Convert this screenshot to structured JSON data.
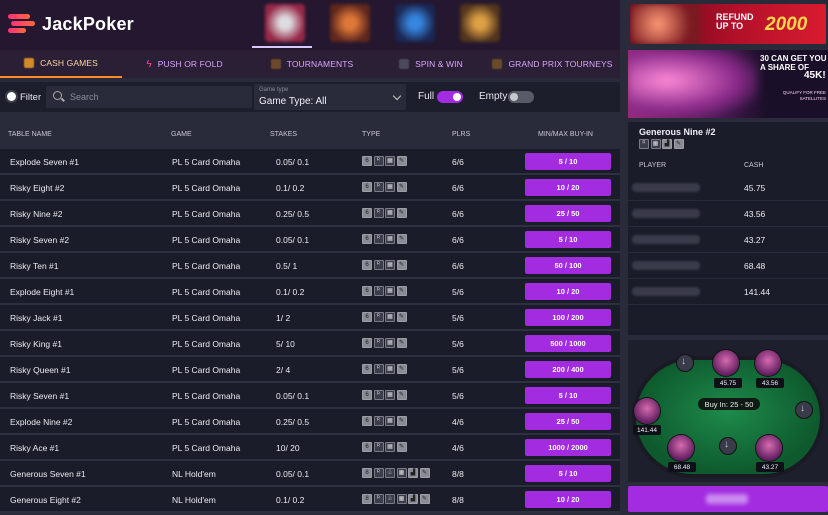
{
  "brand": {
    "name": "JackPoker",
    "accent": "#a32be0",
    "logo_gradient": [
      "#ff2f7a",
      "#ff6a3d"
    ]
  },
  "tabs": [
    {
      "label": "CASH GAMES",
      "icon": "chips-icon",
      "active": true
    },
    {
      "label": "PUSH OR FOLD",
      "icon": "lightning-icon",
      "active": false
    },
    {
      "label": "TOURNAMENTS",
      "icon": "trophy-icon",
      "active": false
    },
    {
      "label": "SPIN & WIN",
      "icon": "spin-icon",
      "active": false
    },
    {
      "label": "GRAND PRIX TOURNEYS",
      "icon": "grand-prix-icon",
      "active": false
    }
  ],
  "filters": {
    "filter_label": "Filter",
    "search_placeholder": "Search",
    "game_type_caption": "Game type",
    "game_type_value": "Game Type: All",
    "full_label": "Full",
    "full_on": true,
    "empty_label": "Empty",
    "empty_on": false
  },
  "table": {
    "headers": [
      "TABLE NAME",
      "GAME",
      "STAKES",
      "TYPE",
      "PLRS",
      "MIN/MAX BUY-IN"
    ],
    "rows": [
      {
        "name": "Explode Seven #1",
        "game": "PL 5 Card Omaha",
        "stakes": "0.05/  0.1",
        "plrs": "6/6",
        "buyin": "5 /  10",
        "types": [
          "6",
          "rabbit",
          "deck",
          "pen"
        ]
      },
      {
        "name": "Risky Eight #2",
        "game": "PL 5 Card Omaha",
        "stakes": "0.1/  0.2",
        "plrs": "6/6",
        "buyin": "10 /  20",
        "types": [
          "6",
          "rabbit",
          "deck",
          "pen"
        ]
      },
      {
        "name": "Risky Nine #2",
        "game": "PL 5 Card Omaha",
        "stakes": "0.25/  0.5",
        "plrs": "6/6",
        "buyin": "25 /  50",
        "types": [
          "6",
          "rabbit",
          "deck",
          "pen"
        ]
      },
      {
        "name": "Risky Seven #2",
        "game": "PL 5 Card Omaha",
        "stakes": "0.05/  0.1",
        "plrs": "6/6",
        "buyin": "5 /  10",
        "types": [
          "6",
          "rabbit",
          "deck",
          "pen"
        ]
      },
      {
        "name": "Risky Ten #1",
        "game": "PL 5 Card Omaha",
        "stakes": "0.5/  1",
        "plrs": "6/6",
        "buyin": "50 /  100",
        "types": [
          "6",
          "rabbit",
          "deck",
          "pen"
        ]
      },
      {
        "name": "Explode Eight #1",
        "game": "PL 5 Card Omaha",
        "stakes": "0.1/  0.2",
        "plrs": "5/6",
        "buyin": "10 /  20",
        "types": [
          "6",
          "rabbit",
          "deck",
          "pen"
        ]
      },
      {
        "name": "Risky Jack #1",
        "game": "PL 5 Card Omaha",
        "stakes": "1/  2",
        "plrs": "5/6",
        "buyin": "100 /  200",
        "types": [
          "6",
          "rabbit",
          "deck",
          "pen"
        ]
      },
      {
        "name": "Risky King #1",
        "game": "PL 5 Card Omaha",
        "stakes": "5/  10",
        "plrs": "5/6",
        "buyin": "500 /  1000",
        "types": [
          "6",
          "rabbit",
          "deck",
          "pen"
        ]
      },
      {
        "name": "Risky Queen #1",
        "game": "PL 5 Card Omaha",
        "stakes": "2/  4",
        "plrs": "5/6",
        "buyin": "200 /  400",
        "types": [
          "6",
          "rabbit",
          "deck",
          "pen"
        ]
      },
      {
        "name": "Risky Seven #1",
        "game": "PL 5 Card Omaha",
        "stakes": "0.05/  0.1",
        "plrs": "5/6",
        "buyin": "5 /  10",
        "types": [
          "6",
          "rabbit",
          "deck",
          "pen"
        ]
      },
      {
        "name": "Explode Nine #2",
        "game": "PL 5 Card Omaha",
        "stakes": "0.25/  0.5",
        "plrs": "4/6",
        "buyin": "25 /  50",
        "types": [
          "6",
          "rabbit",
          "deck",
          "pen"
        ]
      },
      {
        "name": "Risky Ace #1",
        "game": "PL 5 Card Omaha",
        "stakes": "10/  20",
        "plrs": "4/6",
        "buyin": "1000 /  2000",
        "types": [
          "6",
          "rabbit",
          "deck",
          "pen"
        ]
      },
      {
        "name": "Generous Seven #1",
        "game": "NL Hold'em",
        "stakes": "0.05/  0.1",
        "plrs": "8/8",
        "buyin": "5 /  10",
        "types": [
          "8",
          "rabbit",
          "tree",
          "deck",
          "stats",
          "pen"
        ]
      },
      {
        "name": "Generous Eight #2",
        "game": "NL Hold'em",
        "stakes": "0.1/  0.2",
        "plrs": "8/8",
        "buyin": "10 /  20",
        "types": [
          "8",
          "rabbit",
          "tree",
          "deck",
          "stats",
          "pen"
        ]
      }
    ]
  },
  "promo_banner": {
    "refund_line1": "REFUND",
    "refund_line2": "UP TO",
    "amount": "2000"
  },
  "promo_tile": {
    "line1": "30 CAN GET YOU",
    "line1b": "A SHARE OF",
    "line2": "45K!",
    "line3": "QUALIFY FOR FREE",
    "line3b": "SATELLITES"
  },
  "detail": {
    "title": "Generous Nine #2",
    "icons": [
      "rabbit",
      "deck",
      "stats",
      "pen"
    ],
    "col_player": "PLAYER",
    "col_cash": "CASH",
    "players": [
      {
        "cash": "45.75"
      },
      {
        "cash": "43.56"
      },
      {
        "cash": "43.27"
      },
      {
        "cash": "68.48"
      },
      {
        "cash": "141.44"
      }
    ]
  },
  "poker_table": {
    "buyin_label": "Buy In:",
    "buyin_value": "25 -  50",
    "seats": [
      {
        "cash": "45.75"
      },
      {
        "cash": "43.56"
      },
      {
        "cash": "141.44"
      },
      {
        "cash": "68.48"
      },
      {
        "cash": "43.27"
      }
    ]
  }
}
